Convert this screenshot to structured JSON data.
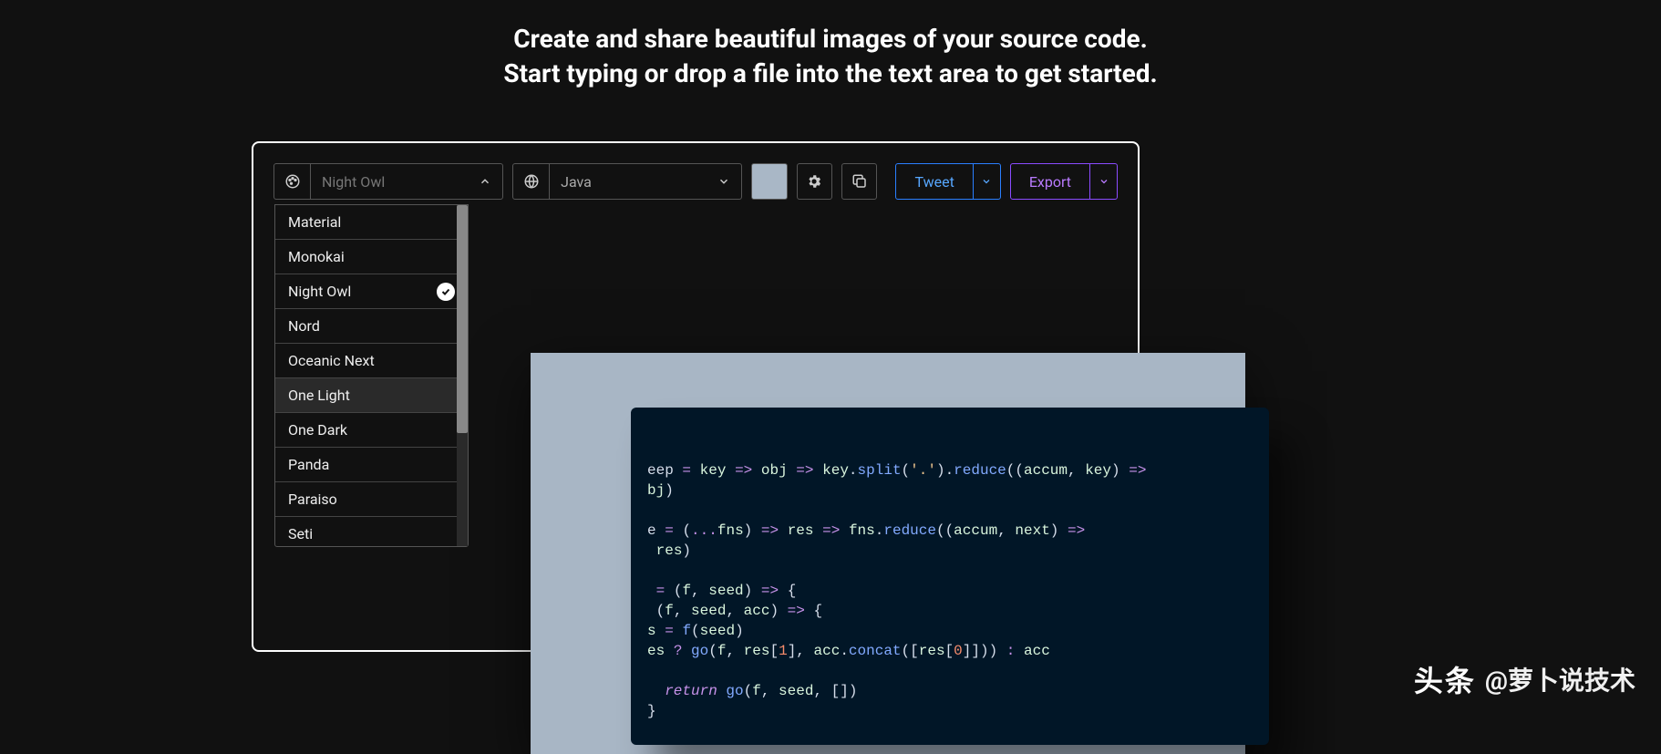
{
  "hero": {
    "line1": "Create and share beautiful images of your source code.",
    "line2": "Start typing or drop a file into the text area to get started."
  },
  "toolbar": {
    "theme": {
      "selected": "Night Owl",
      "options": [
        {
          "label": "Material",
          "selected": false
        },
        {
          "label": "Monokai",
          "selected": false
        },
        {
          "label": "Night Owl",
          "selected": true
        },
        {
          "label": "Nord",
          "selected": false
        },
        {
          "label": "Oceanic Next",
          "selected": false
        },
        {
          "label": "One Light",
          "selected": false,
          "hovered": true
        },
        {
          "label": "One Dark",
          "selected": false
        },
        {
          "label": "Panda",
          "selected": false
        },
        {
          "label": "Paraiso",
          "selected": false
        },
        {
          "label": "Seti",
          "selected": false
        }
      ]
    },
    "language": {
      "selected": "Java"
    },
    "background_color": "#a9b7c6",
    "tweet_label": "Tweet",
    "export_label": "Export"
  },
  "code": {
    "lines": [
      "eep = key => obj => key.split('.').reduce((accum, key) =>",
      "bj)",
      "",
      "e = (...fns) => res => fns.reduce((accum, next) =>",
      "res)",
      "",
      " = (f, seed) => {",
      "(f, seed, acc) => {",
      "s = f(seed)",
      "es ? go(f, res[1], acc.concat([res[0]])) : acc",
      "",
      "  return go(f, seed, [])",
      "}"
    ]
  },
  "watermark": {
    "brand": "头条",
    "handle": "@萝卜说技术"
  }
}
